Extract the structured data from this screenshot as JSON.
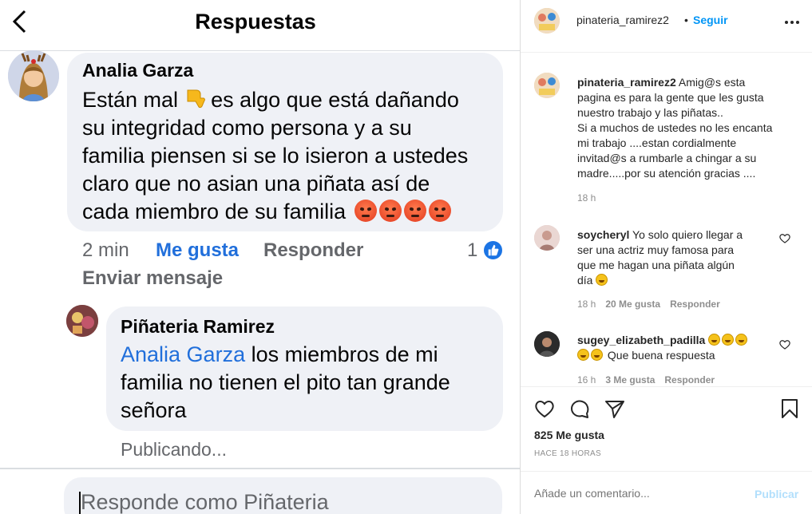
{
  "left": {
    "title": "Respuestas",
    "comment": {
      "author": "Analia Garza",
      "text_lines": [
        "Están mal",
        "es algo que está dañando",
        "su integridad como persona y a su",
        "familia piensen si se lo isieron a ustedes",
        "claro que no asian una piñata así de",
        "cada miembro de su familia"
      ],
      "time": "2 min",
      "like_label": "Me gusta",
      "reply_label": "Responder",
      "like_count": "1",
      "send_message": "Enviar mensaje"
    },
    "reply": {
      "author": "Piñateria Ramirez",
      "mention": "Analia Garza",
      "text_lines": [
        "los miembros de mi",
        "familia no tienen el pito tan grande",
        "señora"
      ],
      "status": "Publicando..."
    },
    "compose_placeholder": "Responde como Piñateria"
  },
  "instagram": {
    "username": "pinateria_ramirez2",
    "separator": "•",
    "follow": "Seguir",
    "caption": {
      "username": "pinateria_ramirez2",
      "lines": [
        "Amig@s esta",
        "pagina es para la gente que les gusta",
        "nuestro trabajo y las piñatas..",
        "Si a muchos de ustedes no les encanta",
        "mi trabajo ....estan cordialmente",
        "invitad@s a rumbarle a chingar a su",
        "madre.....por su atención gracias ...."
      ],
      "time": "18 h"
    },
    "comments": [
      {
        "username": "soycheryl",
        "lines": [
          "Yo solo quiero llegar a",
          "ser una actriz muy famosa para",
          "que me hagan una piñata algún",
          "día"
        ],
        "time": "18 h",
        "likes": "20 Me gusta",
        "reply": "Responder"
      },
      {
        "username": "sugey_elizabeth_padilla",
        "lines": [
          "Que buena respuesta"
        ],
        "time": "16 h",
        "likes": "3 Me gusta",
        "reply": "Responder"
      }
    ],
    "likes": "825 Me gusta",
    "date": "HACE 18 HORAS",
    "add_comment_placeholder": "Añade un comentario...",
    "publish": "Publicar",
    "colors": {
      "link": "#0095f6",
      "publish_disabled": "#b2dffc",
      "fb_blue": "#216fdb"
    }
  }
}
